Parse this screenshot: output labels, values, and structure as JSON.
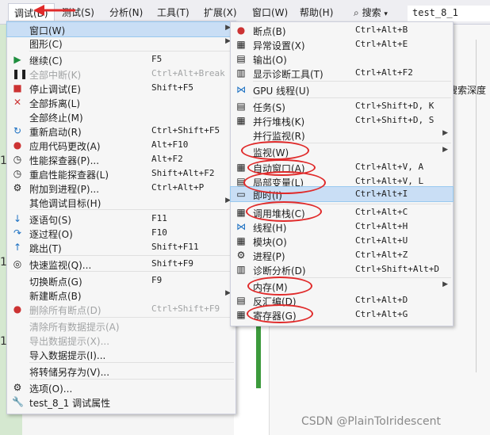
{
  "menubar": {
    "items": [
      "调试(D)",
      "测试(S)",
      "分析(N)",
      "工具(T)",
      "扩展(X)",
      "窗口(W)",
      "帮助(H)"
    ],
    "search_label": "搜索",
    "solution_title": "test_8_1"
  },
  "background": {
    "search_depth": "搜索深度",
    "line_numbers": [
      "1",
      "1",
      "1"
    ]
  },
  "debug_menu": {
    "items": [
      {
        "icon": "",
        "label": "窗口(W)",
        "shortcut": "",
        "submenu": true,
        "highlight": true,
        "disabled": false
      },
      {
        "icon": "",
        "label": "图形(C)",
        "shortcut": "",
        "submenu": true,
        "disabled": false
      },
      {
        "icon": "▶",
        "label": "继续(C)",
        "shortcut": "F5",
        "disabled": false
      },
      {
        "icon": "❚❚",
        "label": "全部中断(K)",
        "shortcut": "Ctrl+Alt+Break",
        "disabled": true
      },
      {
        "icon": "■",
        "label": "停止调试(E)",
        "shortcut": "Shift+F5",
        "disabled": false
      },
      {
        "icon": "✕",
        "label": "全部拆离(L)",
        "shortcut": "",
        "disabled": false
      },
      {
        "icon": "",
        "label": "全部终止(M)",
        "shortcut": "",
        "disabled": false
      },
      {
        "icon": "↻",
        "label": "重新启动(R)",
        "shortcut": "Ctrl+Shift+F5",
        "disabled": false
      },
      {
        "icon": "●",
        "label": "应用代码更改(A)",
        "shortcut": "Alt+F10",
        "disabled": false
      },
      {
        "icon": "◷",
        "label": "性能探查器(P)...",
        "shortcut": "Alt+F2",
        "disabled": false
      },
      {
        "icon": "◷",
        "label": "重启性能探查器(L)",
        "shortcut": "Shift+Alt+F2",
        "disabled": false
      },
      {
        "icon": "⚙",
        "label": "附加到进程(P)...",
        "shortcut": "Ctrl+Alt+P",
        "disabled": false
      },
      {
        "icon": "",
        "label": "其他调试目标(H)",
        "shortcut": "",
        "submenu": true,
        "disabled": false
      },
      {
        "icon": "↓",
        "label": "逐语句(S)",
        "shortcut": "F11",
        "disabled": false
      },
      {
        "icon": "↷",
        "label": "逐过程(O)",
        "shortcut": "F10",
        "disabled": false
      },
      {
        "icon": "↑",
        "label": "跳出(T)",
        "shortcut": "Shift+F11",
        "disabled": false
      },
      {
        "icon": "◎",
        "label": "快速监视(Q)...",
        "shortcut": "Shift+F9",
        "disabled": false
      },
      {
        "icon": "",
        "label": "切换断点(G)",
        "shortcut": "F9",
        "disabled": false
      },
      {
        "icon": "",
        "label": "新建断点(B)",
        "shortcut": "",
        "submenu": true,
        "disabled": false
      },
      {
        "icon": "●",
        "label": "删除所有断点(D)",
        "shortcut": "Ctrl+Shift+F9",
        "disabled": true
      },
      {
        "icon": "",
        "label": "清除所有数据提示(A)",
        "shortcut": "",
        "disabled": true
      },
      {
        "icon": "",
        "label": "导出数据提示(X)...",
        "shortcut": "",
        "disabled": true
      },
      {
        "icon": "",
        "label": "导入数据提示(I)...",
        "shortcut": "",
        "disabled": false
      },
      {
        "icon": "",
        "label": "将转储另存为(V)...",
        "shortcut": "",
        "disabled": false
      },
      {
        "icon": "⚙",
        "label": "选项(O)...",
        "shortcut": "",
        "disabled": false
      },
      {
        "icon": "🔧",
        "label": "test_8_1 调试属性",
        "shortcut": "",
        "disabled": false
      }
    ]
  },
  "window_submenu": {
    "items": [
      {
        "icon": "●",
        "label": "断点(B)",
        "shortcut": "Ctrl+Alt+B"
      },
      {
        "icon": "▦",
        "label": "异常设置(X)",
        "shortcut": "Ctrl+Alt+E"
      },
      {
        "icon": "▤",
        "label": "输出(O)",
        "shortcut": ""
      },
      {
        "icon": "▥",
        "label": "显示诊断工具(T)",
        "shortcut": "Ctrl+Alt+F2"
      },
      {
        "icon": "⋈",
        "label": "GPU 线程(U)",
        "shortcut": ""
      },
      {
        "icon": "▤",
        "label": "任务(S)",
        "shortcut": "Ctrl+Shift+D, K"
      },
      {
        "icon": "▦",
        "label": "并行堆栈(K)",
        "shortcut": "Ctrl+Shift+D, S"
      },
      {
        "icon": "",
        "label": "并行监视(R)",
        "shortcut": "",
        "submenu": true
      },
      {
        "icon": "",
        "label": "监视(W)",
        "shortcut": "",
        "submenu": true
      },
      {
        "icon": "▦",
        "label": "自动窗口(A)",
        "shortcut": "Ctrl+Alt+V, A"
      },
      {
        "icon": "▤",
        "label": "局部变量(L)",
        "shortcut": "Ctrl+Alt+V, L"
      },
      {
        "icon": "▭",
        "label": "即时(I)",
        "shortcut": "Ctrl+Alt+I",
        "highlight": true
      },
      {
        "icon": "▦",
        "label": "调用堆栈(C)",
        "shortcut": "Ctrl+Alt+C"
      },
      {
        "icon": "⋈",
        "label": "线程(H)",
        "shortcut": "Ctrl+Alt+H"
      },
      {
        "icon": "▦",
        "label": "模块(O)",
        "shortcut": "Ctrl+Alt+U"
      },
      {
        "icon": "⚙",
        "label": "进程(P)",
        "shortcut": "Ctrl+Alt+Z"
      },
      {
        "icon": "▥",
        "label": "诊断分析(D)",
        "shortcut": "Ctrl+Shift+Alt+D"
      },
      {
        "icon": "",
        "label": "内存(M)",
        "shortcut": "",
        "submenu": true
      },
      {
        "icon": "▤",
        "label": "反汇编(D)",
        "shortcut": "Ctrl+Alt+D"
      },
      {
        "icon": "▦",
        "label": "寄存器(G)",
        "shortcut": "Ctrl+Alt+G"
      }
    ]
  },
  "watermark": "CSDN @PlainToIridescent",
  "colors": {
    "annotation_red": "#e02a2a",
    "highlight_blue": "#c9def5",
    "play_green": "#1e8e3e"
  }
}
